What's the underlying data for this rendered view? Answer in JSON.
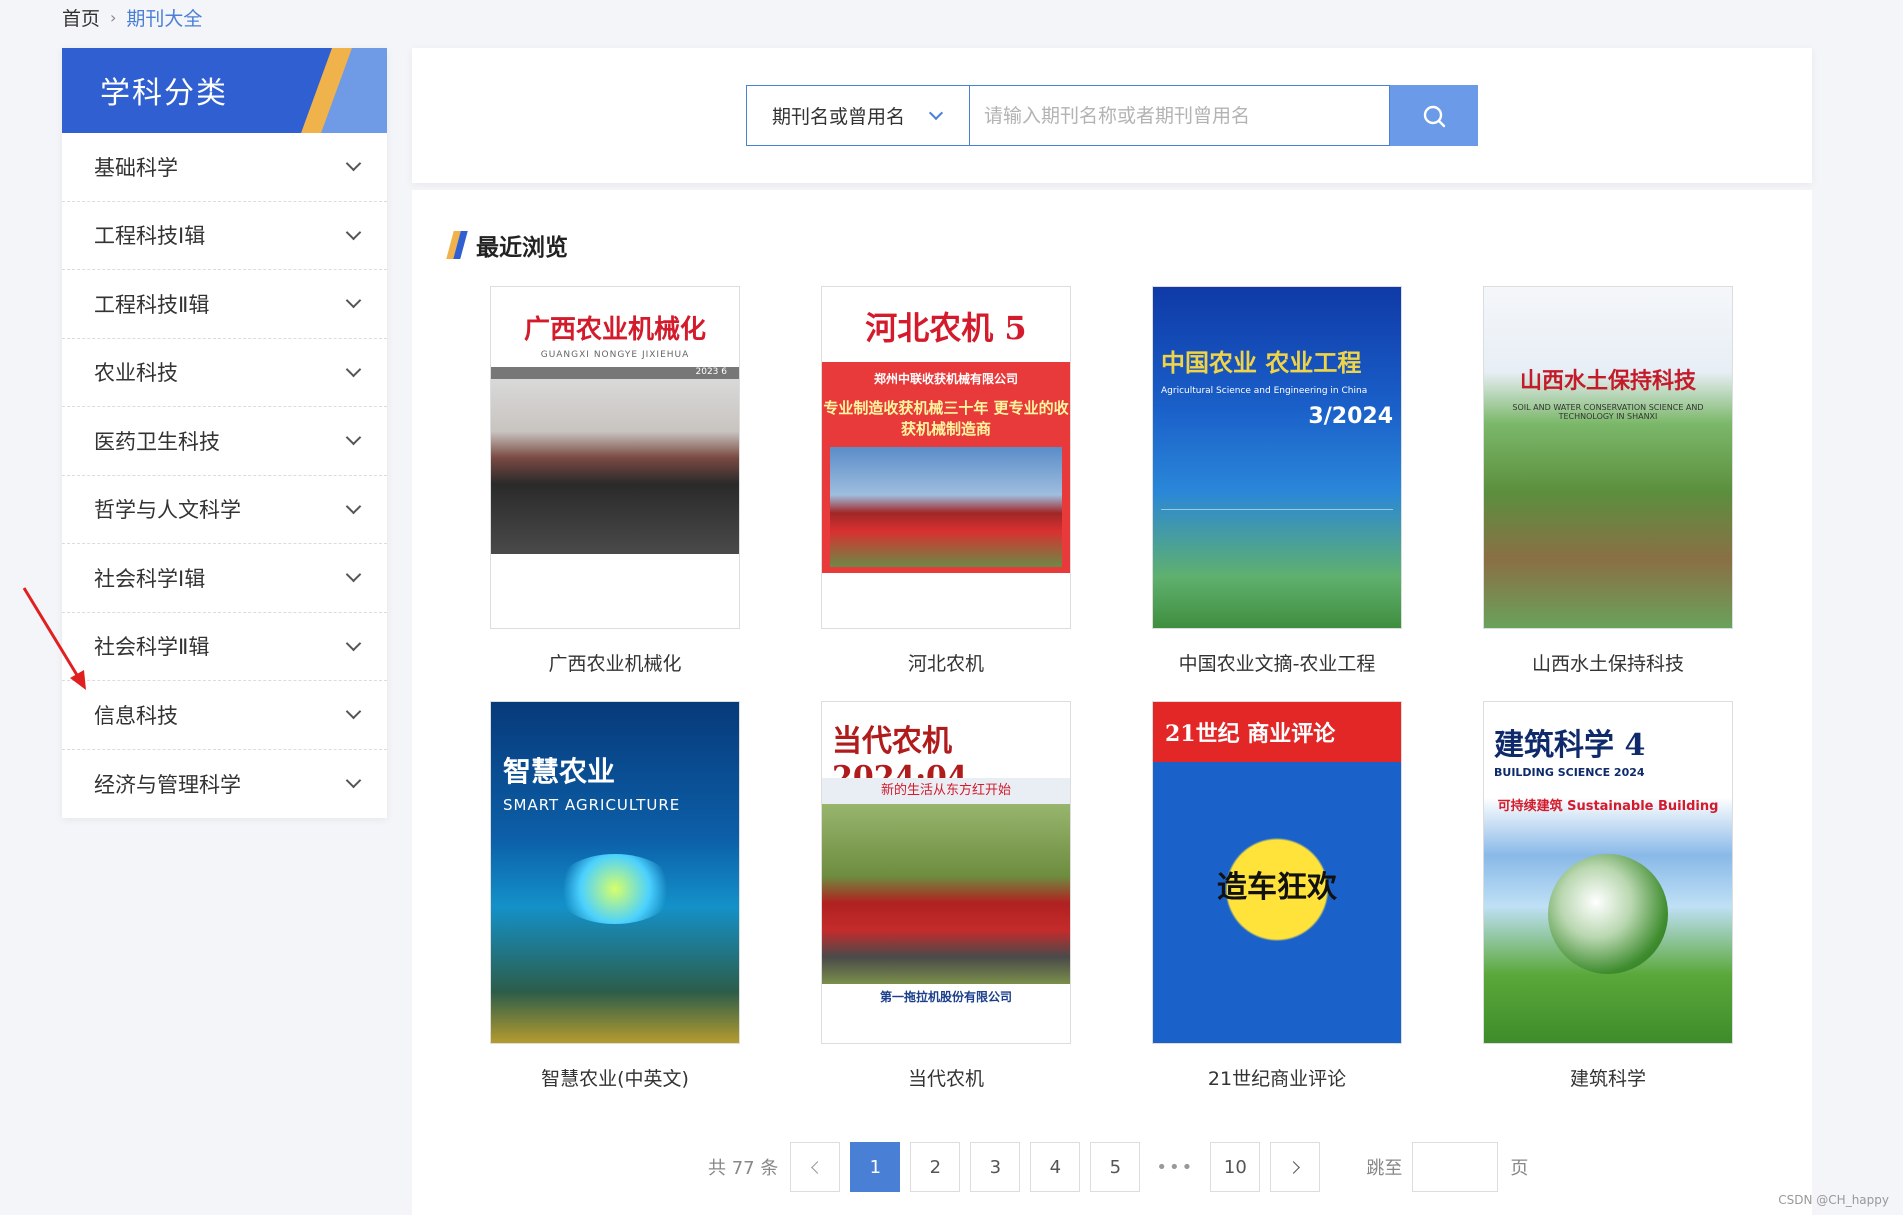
{
  "breadcrumb": {
    "home": "首页",
    "current": "期刊大全"
  },
  "sidebar": {
    "title": "学科分类",
    "items": [
      {
        "label": "基础科学"
      },
      {
        "label": "工程科技Ⅰ辑"
      },
      {
        "label": "工程科技Ⅱ辑"
      },
      {
        "label": "农业科技"
      },
      {
        "label": "医药卫生科技"
      },
      {
        "label": "哲学与人文科学"
      },
      {
        "label": "社会科学Ⅰ辑"
      },
      {
        "label": "社会科学Ⅱ辑"
      },
      {
        "label": "信息科技"
      },
      {
        "label": "经济与管理科学"
      }
    ]
  },
  "search": {
    "select_value": "期刊名或曾用名",
    "placeholder": "请输入期刊名称或者期刊曾用名"
  },
  "recent": {
    "title": "最近浏览",
    "items": [
      {
        "name": "广西农业机械化",
        "cover_title": "广西农业机械化",
        "cover_sub": "GUANGXI NONGYE JIXIEHUA",
        "cover_issue": "2023 6"
      },
      {
        "name": "河北农机",
        "cover_title": "河北农机 5",
        "cover_sub": "郑州中联收获机械有限公司",
        "cover_slogan": "专业制造收获机械三十年 更专业的收获机械制造商"
      },
      {
        "name": "中国农业文摘-农业工程",
        "cover_title": "中国农业 农业工程",
        "cover_sub": "Agricultural Science and Engineering in China",
        "cover_issue": "3/2024"
      },
      {
        "name": "山西水土保持科技",
        "cover_title": "山西水土保持科技",
        "cover_sub": "SOIL AND WATER CONSERVATION SCIENCE AND TECHNOLOGY IN SHANXI"
      },
      {
        "name": "智慧农业(中英文)",
        "cover_title": "智慧农业",
        "cover_sub": "SMART AGRICULTURE"
      },
      {
        "name": "当代农机",
        "cover_title": "当代农机 2024·04",
        "cover_slogan": "新的生活从东方红开始",
        "cover_foot": "第一拖拉机股份有限公司"
      },
      {
        "name": "21世纪商业评论",
        "cover_title": "21世纪 商业评论",
        "cover_bubble": "造车狂欢"
      },
      {
        "name": "建筑科学",
        "cover_title": "建筑科学 4",
        "cover_sub": "BUILDING SCIENCE 2024",
        "cover_slogan": "可持续建筑 Sustainable Building"
      }
    ]
  },
  "pagination": {
    "total": "共 77 条",
    "pages": [
      "1",
      "2",
      "3",
      "4",
      "5"
    ],
    "ellipsis": "•••",
    "last": "10",
    "jump_label": "跳至",
    "jump_unit": "页"
  },
  "watermark": "CSDN @CH_happy",
  "colors": {
    "primary": "#2f5fd1",
    "accent": "#f0b24b",
    "link": "#4a7fd6",
    "annotation": "#e02020"
  }
}
